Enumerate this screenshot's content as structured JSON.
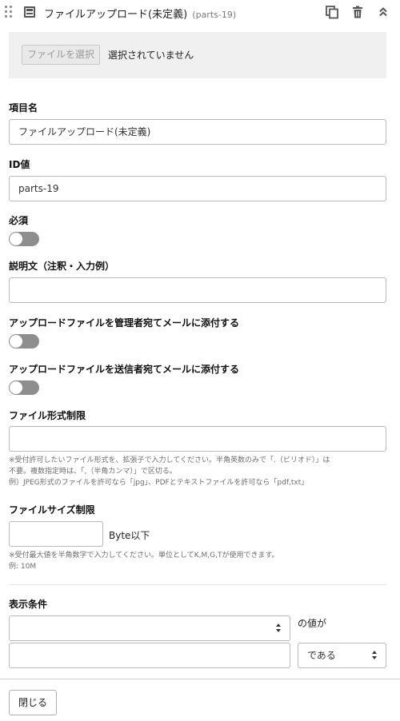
{
  "header": {
    "title": "ファイルアップロード(未定義)",
    "id_tag": "(parts-19)",
    "icons": [
      "drag-handle-icon",
      "form-icon",
      "copy-icon",
      "trash-icon",
      "collapse-icon"
    ]
  },
  "upload": {
    "button_label": "ファイルを選択",
    "status": "選択されていません"
  },
  "fields": {
    "item_name": {
      "label": "項目名",
      "value": "ファイルアップロード(未定義)"
    },
    "id_value": {
      "label": "ID値",
      "value": "parts-19"
    },
    "required": {
      "label": "必須",
      "on": false
    },
    "description": {
      "label": "説明文（注釈・入力例）",
      "value": ""
    },
    "attach_admin": {
      "label": "アップロードファイルを管理者宛てメールに添付する",
      "on": false
    },
    "attach_sender": {
      "label": "アップロードファイルを送信者宛てメールに添付する",
      "on": false
    },
    "file_type": {
      "label": "ファイル形式制限",
      "value": "",
      "note_1": "※受付許可したいファイル形式を、拡張子で入力してください。半角英数のみで「.（ピリオド）」は",
      "note_2": "不要。複数指定時は、「,（半角カンマ）」で区切る。",
      "note_3": "例）JPEG形式のファイルを許可なら「jpg」、PDFとテキストファイルを許可なら「pdf,txt」"
    },
    "file_size": {
      "label": "ファイルサイズ制限",
      "value": "",
      "unit": "Byte以下",
      "note_1": "※受付最大値を半角数字で入力してください。単位としてK,M,G,Tが使用できます。",
      "note_2": "例: 10M"
    },
    "display_condition": {
      "label": "表示条件",
      "field_select": "",
      "value_suffix": "の値が",
      "value_input": "",
      "operator_select": "である"
    }
  },
  "footer": {
    "close_label": "閉じる"
  },
  "colors": {
    "toggle_off": "#8e8e8e",
    "upload_bg": "#f0f0f0",
    "border": "#b8b8b8"
  }
}
